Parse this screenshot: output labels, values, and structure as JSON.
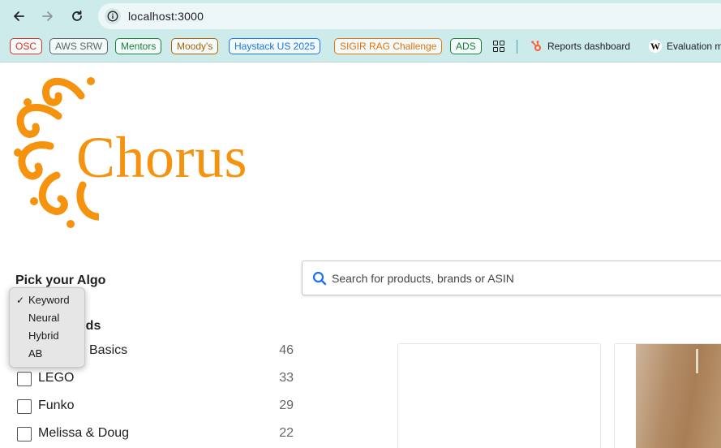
{
  "browser": {
    "url": "localhost:3000"
  },
  "bookmarks": {
    "chips": [
      {
        "label": "OSC",
        "color": "#d93025"
      },
      {
        "label": "AWS SRW",
        "color": "#5f6368"
      },
      {
        "label": "Mentors",
        "color": "#188038"
      },
      {
        "label": "Moody's",
        "color": "#b06000"
      },
      {
        "label": "Haystack US 2025",
        "color": "#1a73e8"
      },
      {
        "label": "SIGIR RAG Challenge",
        "color": "#e8710a"
      },
      {
        "label": "ADS",
        "color": "#188038"
      }
    ],
    "reports": "Reports dashboard",
    "evaluation": "Evaluation m"
  },
  "logo": {
    "text": "Chorus",
    "color": "#f5930f"
  },
  "algo": {
    "title": "Pick your Algo",
    "options": [
      "Keyword",
      "Neural",
      "Hybrid",
      "AB"
    ],
    "selected": "Keyword"
  },
  "brands": {
    "title": "ands",
    "items": [
      {
        "name": "Basics",
        "count": "46"
      },
      {
        "name": "LEGO",
        "count": "33"
      },
      {
        "name": "Funko",
        "count": "29"
      },
      {
        "name": "Melissa & Doug",
        "count": "22"
      }
    ]
  },
  "search": {
    "placeholder": "Search for products, brands or ASIN"
  }
}
